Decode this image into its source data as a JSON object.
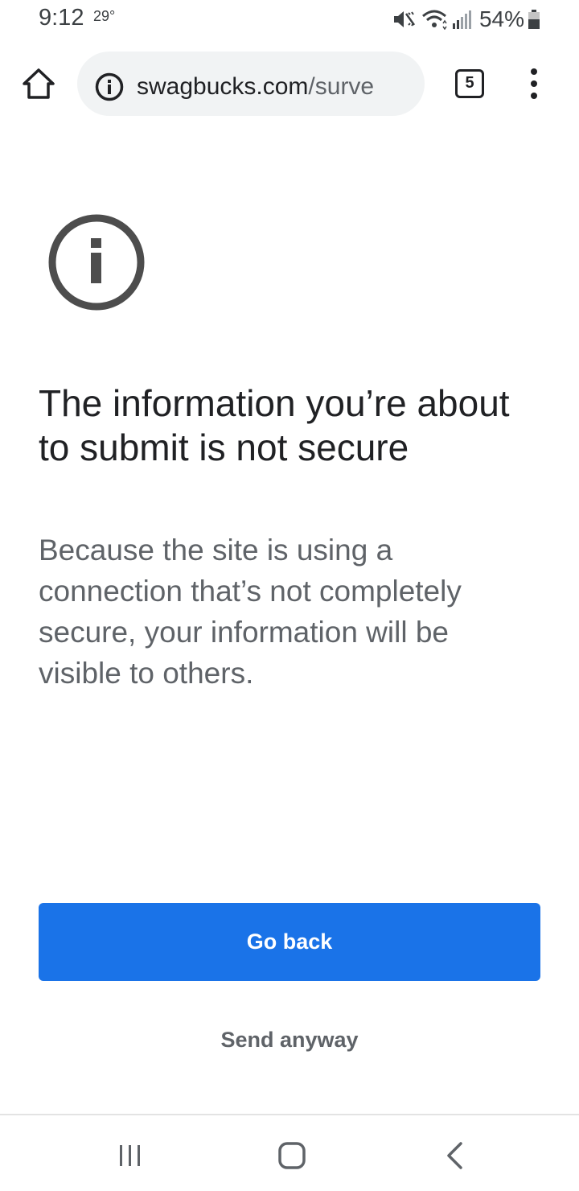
{
  "status_bar": {
    "time": "9:12",
    "temperature": "29°",
    "battery": "54%",
    "icons": [
      "mute-icon",
      "wifi-icon",
      "signal-icon",
      "battery-icon"
    ]
  },
  "toolbar": {
    "url_host": "swagbucks.com",
    "url_path": "/surve",
    "tab_count": "5",
    "icons": [
      "home-icon",
      "info-icon",
      "more-vert-icon"
    ]
  },
  "warning": {
    "title": "The information you’re about to submit is not secure",
    "body": "Because the site is using a connection that’s not completely secure, your information will be visible to others.",
    "primary_button": "Go back",
    "secondary_button": "Send anyway",
    "icon": "info-icon"
  },
  "nav_bar": {
    "icons": [
      "recents-icon",
      "home-icon",
      "back-icon"
    ]
  },
  "colors": {
    "primary": "#1a73e8",
    "text": "#202124",
    "secondary_text": "#5f6368",
    "omnibox_bg": "#f1f3f4"
  }
}
